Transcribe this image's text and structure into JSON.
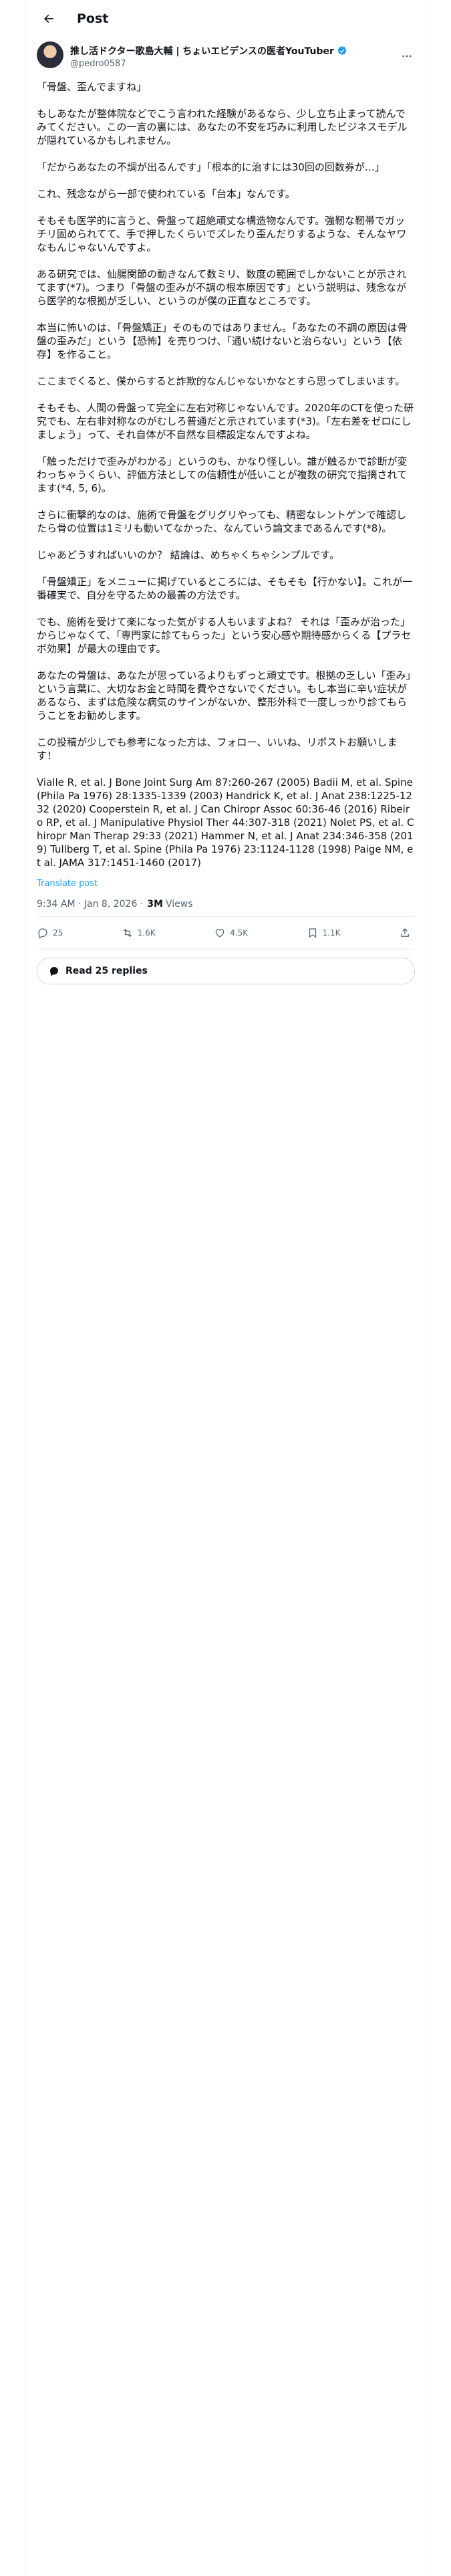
{
  "header": {
    "title": "Post"
  },
  "author": {
    "name": "推し活ドクター歌島大輔 | ちょいエビデンスの医者YouTuber",
    "handle": "@pedro0587"
  },
  "post": {
    "paragraphs": [
      "「骨盤、歪んでますね」",
      "もしあなたが整体院などでこう言われた経験があるなら、少し立ち止まって読んでみてください。この一言の裏には、あなたの不安を巧みに利用したビジネスモデルが隠れているかもしれません。",
      "「だからあなたの不調が出るんです」「根本的に治すには30回の回数券が…」",
      "これ、残念ながら一部で使われている「台本」なんです。",
      "そもそも医学的に言うと、骨盤って超絶頑丈な構造物なんです。強靭な靭帯でガッチリ固められてて、手で押したくらいでズレたり歪んだりするような、そんなヤワなもんじゃないんですよ。",
      "ある研究では、仙腸関節の動きなんて数ミリ、数度の範囲でしかないことが示されてます(*7)。つまり「骨盤の歪みが不調の根本原因です」という説明は、残念ながら医学的な根拠が乏しい、というのが僕の正直なところです。",
      "本当に怖いのは、「骨盤矯正」そのものではありません。「あなたの不調の原因は骨盤の歪みだ」という【恐怖】を売りつけ、「通い続けないと治らない」という【依存】を作ること。",
      "ここまでくると、僕からすると詐欺的なんじゃないかなとすら思ってしまいます。",
      "そもそも、人間の骨盤って完全に左右対称じゃないんです。2020年のCTを使った研究でも、左右非対称なのがむしろ普通だと示されています(*3)。「左右差をゼロにしましょう」って、それ自体が不自然な目標設定なんですよね。",
      "「触っただけで歪みがわかる」というのも、かなり怪しい。誰が触るかで診断が変わっちゃうくらい、評価方法としての信頼性が低いことが複数の研究で指摘されてます(*4, 5, 6)。",
      "さらに衝撃的なのは、施術で骨盤をグリグリやっても、精密なレントゲンで確認したら骨の位置は1ミリも動いてなかった、なんていう論文まであるんです(*8)。",
      "じゃあどうすればいいのか？ 結論は、めちゃくちゃシンプルです。",
      "「骨盤矯正」をメニューに掲げているところには、そもそも【行かない】。これが一番確実で、自分を守るための最善の方法です。",
      "でも、施術を受けて楽になった気がする人もいますよね？ それは「歪みが治った」からじゃなくて、「専門家に診てもらった」という安心感や期待感からくる【プラセボ効果】が最大の理由です。",
      "あなたの骨盤は、あなたが思っているよりもずっと頑丈です。根拠の乏しい「歪み」という言葉に、大切なお金と時間を費やさないでください。もし本当に辛い症状があるなら、まずは危険な病気のサインがないか、整形外科で一度しっかり診てもらうことをお勧めします。",
      "この投稿が少しでも参考になった方は、フォロー、いいね、リポストお願いします！",
      "Vialle R, et al. J Bone Joint Surg Am 87:260-267 (2005) Badii M, et al. Spine (Phila Pa 1976) 28:1335-1339 (2003) Handrick K, et al. J Anat 238:1225-1232 (2020) Cooperstein R, et al. J Can Chiropr Assoc 60:36-46 (2016) Ribeiro RP, et al. J Manipulative Physiol Ther 44:307-318 (2021) Nolet PS, et al. Chiropr Man Therap 29:33 (2021) Hammer N, et al. J Anat 234:346-358 (2019) Tullberg T, et al. Spine (Phila Pa 1976) 23:1124-1128 (1998) Paige NM, et al. JAMA 317:1451-1460 (2017)"
    ],
    "translate_label": "Translate post",
    "timestamp": "9:34 AM · Jan 8, 2026",
    "views_count": "3M",
    "views_label": "Views"
  },
  "actions": {
    "replies": "25",
    "reposts": "1.6K",
    "likes": "4.5K",
    "bookmarks": "1.1K"
  },
  "read_replies_label": "Read 25 replies",
  "colors": {
    "accent": "#1d9bf0",
    "text": "#0f1419",
    "secondary": "#536471"
  }
}
